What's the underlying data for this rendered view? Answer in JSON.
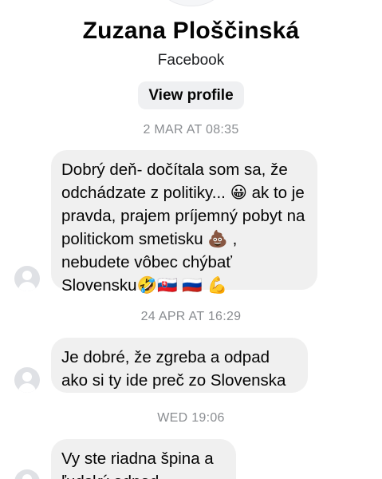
{
  "profile": {
    "name": "Zuzana Ploščinská",
    "source": "Facebook",
    "view_profile_label": "View profile"
  },
  "messages": [
    {
      "timestamp": "2 MAR AT 08:35",
      "text": "Dobrý deň- dočítala som sa, že odchádzate z politiky... 😀 ak to je pravda, prajem príjemný pobyt na politickom smetisku 💩 , nebudete vôbec chýbať Slovensku🤣🇸🇰 🇷🇺 💪"
    },
    {
      "timestamp": "24 APR AT 16:29",
      "text": "Je dobré, že zgreba a odpad ako si ty ide preč zo Slovenska"
    },
    {
      "timestamp": "WED 19:06",
      "text": "Vy ste riadna špina a ľudský odpad"
    }
  ]
}
